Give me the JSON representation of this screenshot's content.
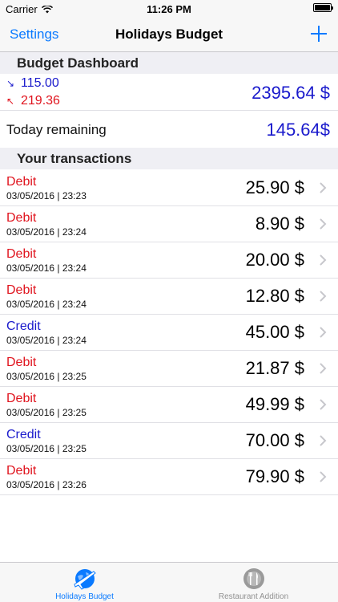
{
  "status_bar": {
    "carrier": "Carrier",
    "time": "11:26 PM"
  },
  "nav": {
    "left_label": "Settings",
    "title": "Holidays Budget",
    "add_icon": "plus-icon"
  },
  "dashboard": {
    "header": "Budget Dashboard",
    "income": "115.00",
    "expense": "219.36",
    "total": "2395.64 $",
    "today_label": "Today remaining",
    "today_value": "145.64$"
  },
  "transactions": {
    "header": "Your transactions",
    "items": [
      {
        "type": "Debit",
        "date": "03/05/2016 | 23:23",
        "amount": "25.90 $"
      },
      {
        "type": "Debit",
        "date": "03/05/2016 | 23:24",
        "amount": "8.90 $"
      },
      {
        "type": "Debit",
        "date": "03/05/2016 | 23:24",
        "amount": "20.00 $"
      },
      {
        "type": "Debit",
        "date": "03/05/2016 | 23:24",
        "amount": "12.80 $"
      },
      {
        "type": "Credit",
        "date": "03/05/2016 | 23:24",
        "amount": "45.00 $"
      },
      {
        "type": "Debit",
        "date": "03/05/2016 | 23:25",
        "amount": "21.87 $"
      },
      {
        "type": "Debit",
        "date": "03/05/2016 | 23:25",
        "amount": "49.99 $"
      },
      {
        "type": "Credit",
        "date": "03/05/2016 | 23:25",
        "amount": "70.00 $"
      },
      {
        "type": "Debit",
        "date": "03/05/2016 | 23:26",
        "amount": "79.90 $"
      }
    ]
  },
  "tabs": [
    {
      "label": "Holidays Budget",
      "icon": "globe-plane-icon",
      "active": true
    },
    {
      "label": "Restaurant Addition",
      "icon": "fork-knife-icon",
      "active": false
    }
  ],
  "colors": {
    "accent": "#0a7aff",
    "credit": "#1a1acc",
    "debit": "#e0141e"
  }
}
